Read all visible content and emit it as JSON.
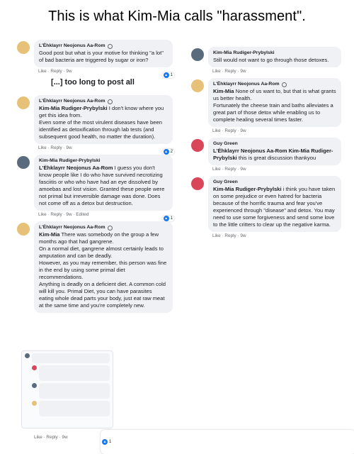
{
  "title": "This is what Kim-Mia calls \"harassment\".",
  "left": {
    "c1": {
      "author": "L'Ëhklayrr Neojonus Aa-Rom",
      "text": "Good post but what is your motive for thinking \"a lot\" of bad bacteria are triggered by sugar or iron?",
      "meta": "Like · Reply · 9w",
      "reactions": "1"
    },
    "note": "[...] too long to post all",
    "c2": {
      "author": "L'Ëhklayrr Neojonus Aa-Rom",
      "tag": "Kim-Mia Rudiger-Prybylski",
      "text": " I don't know where you get this idea from.\nEven some of the most virulent diseases have been identified as detoxification through lab tests (and subsequent good health, no matter the duration).",
      "meta": "Like · Reply · 9w",
      "reactions": "2"
    },
    "c3": {
      "author": "Kim-Mia Rudiger-Prybylski",
      "tag": "L'Ëhklayrr Neojonus Aa-Rom",
      "text": " I guess you don't know people like I do who have survived necrotizing fasciitis or who who have had an eye dissolved by amoebas and lost vision. Granted these people were not primal but irreversible damage was done. Does not come off as a detox but destruction.",
      "meta": "Like · Reply · 9w · Edited",
      "reactions": "1"
    },
    "c4": {
      "author": "L'Ëhklayrr Neojonus Aa-Rom",
      "tag": "Kim-Mia",
      "text": " There was somebody on the group a few months ago that had gangrene.\nOn a normal diet, gangrene almost certainly leads to amputation and can be deadly.\nHowever, as you may remember, this person was fine in the end by using some primal diet recommendations.\nAnything is deadly on a deficient diet. A common cold will kill you. Primal Diet, you can have parasites eating whole dead parts your body, just eat raw meat at the same time and you're completely new."
    },
    "bottom": {
      "meta": "Like · Reply · 9w",
      "reactions": "1"
    }
  },
  "right": {
    "r1": {
      "author": "Kim-Mia Rudiger-Prybylski",
      "text": "Still would not want to go through those detoxes.",
      "meta": "Like · Reply · 9w"
    },
    "r2": {
      "author": "L'Ëhklayrr Neojonus Aa-Rom",
      "tag": "Kim-Mia",
      "text": " None of us want to, but that is what grants us better health.\nFortunately the cheese train and baths alleviates a great part of those detox while enabling us to complete healing several times faster.",
      "meta": "Like · Reply · 9w"
    },
    "r3": {
      "author": "Guy Green",
      "tag": "L'Ëhklayrr Neojonus Aa-Rom Kim-Mia Rudiger-Prybylski",
      "text": " this is great discussion thankyou",
      "meta": "Like · Reply · 9w"
    },
    "r4": {
      "author": "Guy Green",
      "tag": "Kim-Mia Rudiger-Prybylski",
      "text": " i think you have taken on some prejudice or even hatred for bacteria because of the horrific trauma and fear you've experienced through \"disease\" and detox. You may need to use some forgiveness and send some love to the little critters to clear up the negative karma.",
      "meta": "Like · Reply · 9w"
    }
  }
}
